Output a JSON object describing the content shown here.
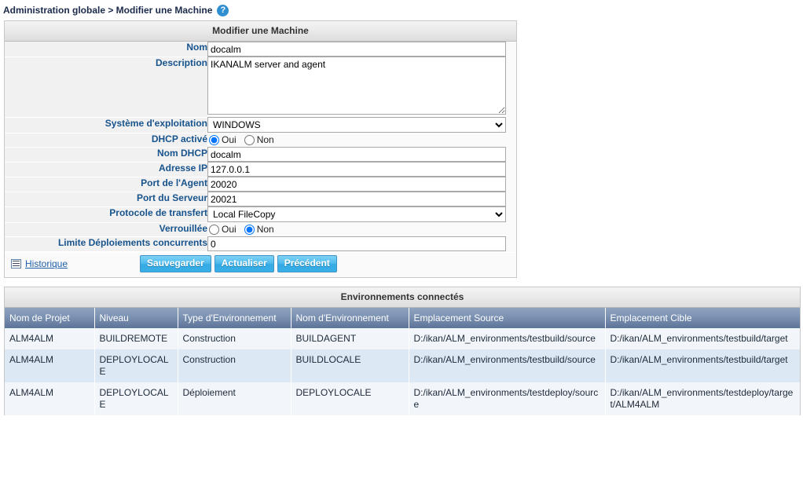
{
  "breadcrumb": {
    "text": "Administration globale > Modifier une Machine",
    "help_icon": "help-circle-icon",
    "help_glyph": "?"
  },
  "form_panel": {
    "title": "Modifier une Machine",
    "fields": {
      "nom": {
        "label": "Nom",
        "value": "docalm"
      },
      "description": {
        "label": "Description",
        "value": "IKANALM server and agent"
      },
      "os": {
        "label": "Système d'exploitation",
        "value": "WINDOWS"
      },
      "dhcp_enabled": {
        "label": "DHCP activé",
        "yes": "Oui",
        "no": "Non",
        "selected": "Oui"
      },
      "dhcp_name": {
        "label": "Nom DHCP",
        "value": "docalm"
      },
      "ip": {
        "label": "Adresse IP",
        "value": "127.0.0.1"
      },
      "agent_port": {
        "label": "Port de l'Agent",
        "value": "20020"
      },
      "server_port": {
        "label": "Port du Serveur",
        "value": "20021"
      },
      "transfer_protocol": {
        "label": "Protocole de transfert",
        "value": "Local FileCopy"
      },
      "locked": {
        "label": "Verrouillée",
        "yes": "Oui",
        "no": "Non",
        "selected": "Non"
      },
      "deploy_limit": {
        "label": "Limite Déploiements concurrents",
        "value": "0"
      }
    },
    "actions": {
      "history_icon": "table-grid-icon",
      "history_label": "Historique",
      "save_label": "Sauvegarder",
      "refresh_label": "Actualiser",
      "back_label": "Précédent"
    }
  },
  "environments_panel": {
    "title": "Environnements connectés",
    "columns": [
      "Nom de Projet",
      "Niveau",
      "Type d'Environnement",
      "Nom d'Environnement",
      "Emplacement Source",
      "Emplacement Cible"
    ],
    "rows": [
      {
        "project": "ALM4ALM",
        "level": "BUILDREMOTE",
        "type": "Construction",
        "name": "BUILDAGENT",
        "source": "D:/ikan/ALM_environments/testbuild/source",
        "target": "D:/ikan/ALM_environments/testbuild/target"
      },
      {
        "project": "ALM4ALM",
        "level": "DEPLOYLOCALE",
        "type": "Construction",
        "name": "BUILDLOCALE",
        "source": "D:/ikan/ALM_environments/testbuild/source",
        "target": "D:/ikan/ALM_environments/testbuild/target"
      },
      {
        "project": "ALM4ALM",
        "level": "DEPLOYLOCALE",
        "type": "Déploiement",
        "name": "DEPLOYLOCALE",
        "source": "D:/ikan/ALM_environments/testdeploy/source",
        "target": "D:/ikan/ALM_environments/testdeploy/target/ALM4ALM"
      }
    ]
  },
  "colors": {
    "label_blue": "#17538c",
    "button_blue": "#34a9e4",
    "grid_header": "#7e94b4",
    "row_even": "#dce8f4",
    "row_odd": "#f2f5f9"
  }
}
